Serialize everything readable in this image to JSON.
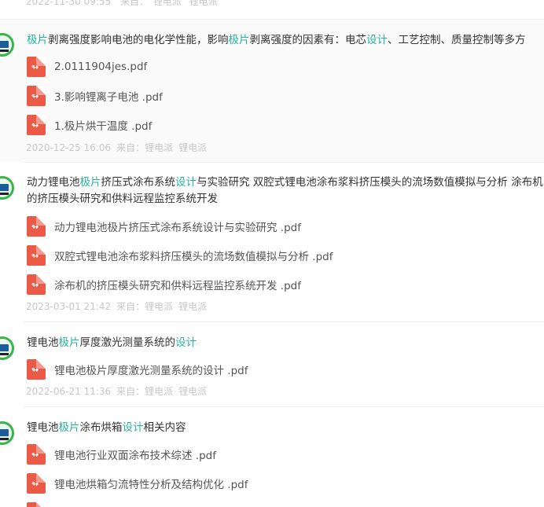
{
  "top_meta": {
    "time": "2022-11-30 09:55",
    "from": "来自：",
    "src1": "锂电派",
    "src2": "锂电派"
  },
  "posts": [
    {
      "title_parts": [
        {
          "t": "极片",
          "hl": true
        },
        {
          "t": "剥离强度影响电池的电化学性能，影响",
          "hl": false
        },
        {
          "t": "极片",
          "hl": true
        },
        {
          "t": "剥离强度的因素有：电芯",
          "hl": false
        },
        {
          "t": "设计",
          "hl": true
        },
        {
          "t": "、工艺控制、质量控制等多方",
          "hl": false
        }
      ],
      "files": [
        "2.0111904jes.pdf",
        "3.影响锂离子电池 .pdf",
        "1.极片烘干温度 .pdf"
      ],
      "time": "2020-12-25 16:06",
      "from": "来自：",
      "src1": "锂电派",
      "src2": "锂电派"
    },
    {
      "title_parts": [
        {
          "t": "动力锂电池",
          "hl": false
        },
        {
          "t": "极片",
          "hl": true
        },
        {
          "t": "挤压式涂布系统",
          "hl": false
        },
        {
          "t": "设计",
          "hl": true
        },
        {
          "t": "与实验研究  双腔式锂电池涂布浆料挤压模头的流场数值模拟与分析 涂布机的挤压模头研究和供料远程监控系统开发",
          "hl": false
        }
      ],
      "files": [
        "动力锂电池极片挤压式涂布系统设计与实验研究 .pdf",
        "双腔式锂电池涂布浆料挤压模头的流场数值模拟与分析 .pdf",
        "涂布机的挤压模头研究和供料远程监控系统开发 .pdf"
      ],
      "time": "2023-03-01 21:42",
      "from": "来自：",
      "src1": "锂电派",
      "src2": "锂电派"
    },
    {
      "title_parts": [
        {
          "t": "锂电池",
          "hl": false
        },
        {
          "t": "极片",
          "hl": true
        },
        {
          "t": "厚度激光测量系统的",
          "hl": false
        },
        {
          "t": "设计",
          "hl": true
        }
      ],
      "files": [
        "锂电池极片厚度激光测量系统的设计 .pdf"
      ],
      "time": "2022-06-21 11:36",
      "from": "来自：",
      "src1": "锂电派",
      "src2": "锂电派"
    },
    {
      "title_parts": [
        {
          "t": "锂电池",
          "hl": false
        },
        {
          "t": "极片",
          "hl": true
        },
        {
          "t": "涂布烘箱",
          "hl": false
        },
        {
          "t": "设计",
          "hl": true
        },
        {
          "t": "相关内容",
          "hl": false
        }
      ],
      "files": [
        "锂电池行业双面涂布技术综述 .pdf",
        "锂电池烘箱匀流特性分析及结构优化 .pdf",
        ""
      ],
      "time": "",
      "from": "",
      "src1": "",
      "src2": ""
    }
  ],
  "colors": {
    "highlight": "#27b3a1",
    "pdf_red": "#ea5a47",
    "meta_gray": "#c7c7c7",
    "avatar_ring": "#39b54a"
  },
  "icons": {
    "avatar": "user-avatar-icon",
    "file": "pdf-file-icon"
  }
}
